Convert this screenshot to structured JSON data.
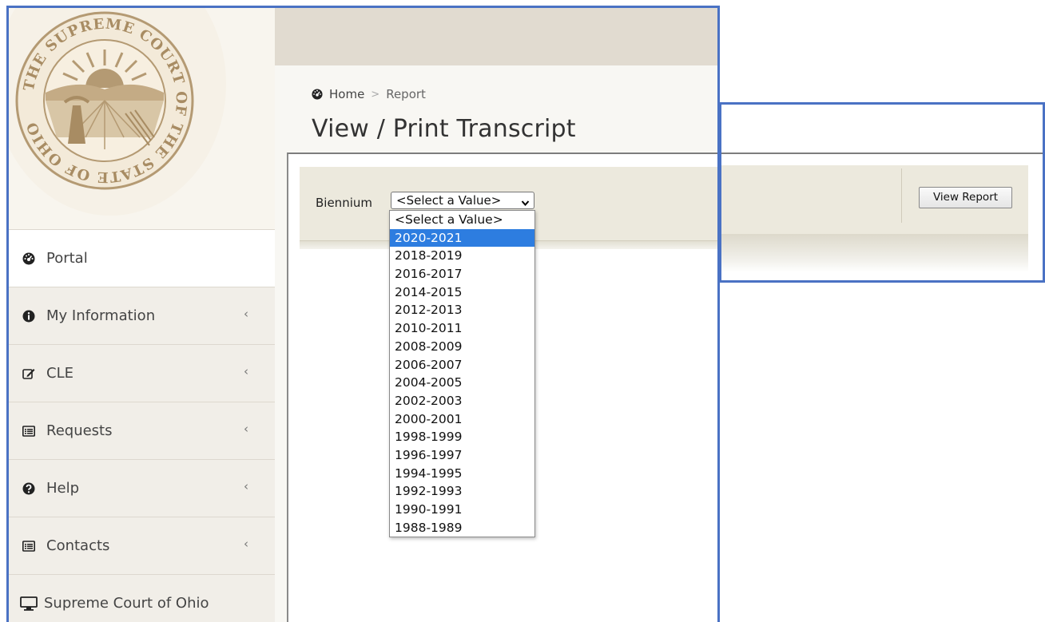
{
  "sidebar": {
    "items": [
      {
        "label": "Portal",
        "icon": "dashboard-icon",
        "has_chevron": false
      },
      {
        "label": "My Information",
        "icon": "info-circle-icon",
        "has_chevron": true
      },
      {
        "label": "CLE",
        "icon": "edit-icon",
        "has_chevron": true
      },
      {
        "label": "Requests",
        "icon": "list-icon",
        "has_chevron": true
      },
      {
        "label": "Help",
        "icon": "question-circle-icon",
        "has_chevron": true
      },
      {
        "label": "Contacts",
        "icon": "list-icon",
        "has_chevron": true
      },
      {
        "label": "Supreme Court of Ohio",
        "icon": "desktop-icon",
        "has_chevron": false
      }
    ],
    "chevron": "‹"
  },
  "breadcrumb": {
    "home": "Home",
    "separator": ">",
    "current": "Report"
  },
  "page": {
    "title": "View / Print Transcript"
  },
  "report": {
    "parameter_label": "Biennium",
    "select_value": "<Select a Value>",
    "options": [
      "<Select a Value>",
      "2020-2021",
      "2018-2019",
      "2016-2017",
      "2014-2015",
      "2012-2013",
      "2010-2011",
      "2008-2009",
      "2006-2007",
      "2004-2005",
      "2002-2003",
      "2000-2001",
      "1998-1999",
      "1996-1997",
      "1994-1995",
      "1992-1993",
      "1990-1991",
      "1988-1989"
    ],
    "highlighted_option": "2020-2021",
    "view_report_label": "View Report"
  },
  "seal": {
    "text": "THE SUPREME COURT OF THE STATE OF OHIO"
  },
  "colors": {
    "frame_border": "#4a72c4",
    "highlight": "#2d7de0",
    "param_bar": "#ece9dd",
    "seal": "#b49a73"
  }
}
